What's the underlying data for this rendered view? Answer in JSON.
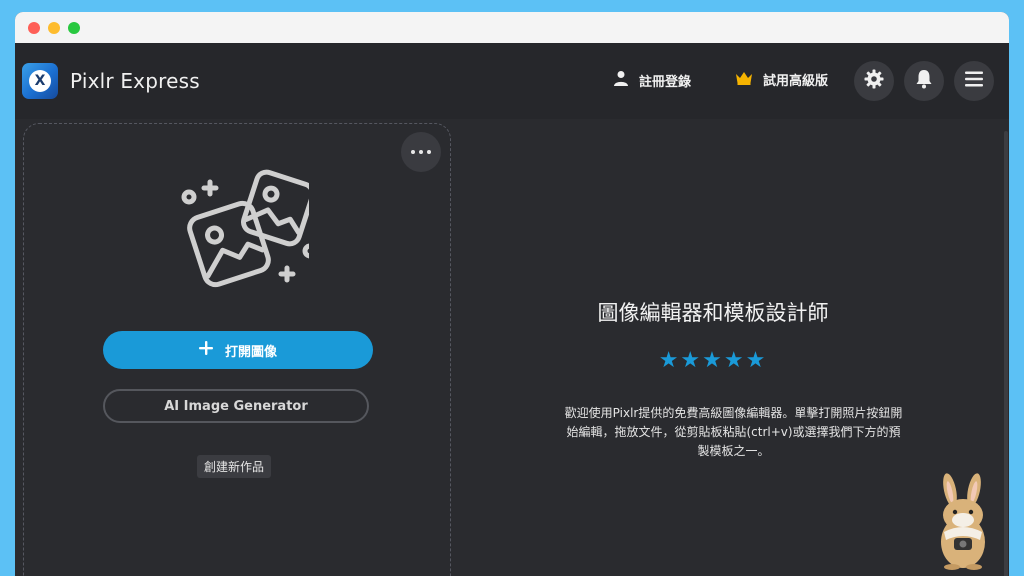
{
  "app": {
    "name": "Pixlr Express",
    "logo_letter": "X"
  },
  "header": {
    "register_label": "註冊登錄",
    "premium_label": "試用高級版",
    "premium_icon_color": "#f5b301"
  },
  "icons": {
    "user": "user-icon",
    "crown": "crown-icon",
    "settings": "gear-icon",
    "bell": "bell-icon",
    "menu": "hamburger-menu-icon",
    "more": "ellipsis-icon",
    "plus": "plus-icon"
  },
  "panel": {
    "open_button_label": "打開圖像",
    "ai_button_label": "AI Image Generator",
    "create_new_label": "創建新作品"
  },
  "hero": {
    "title": "圖像編輯器和模板設計師",
    "rating": 5,
    "stars": "★★★★★",
    "description": "歡迎使用Pixlr提供的免費高級圖像編輯器。單擊打開照片按鈕開始編輯，拖放文件，從剪貼板粘貼(ctrl+v)或選擇我們下方的預製模板之一。"
  },
  "colors": {
    "accent": "#1a9ad8",
    "background": "#2a2b2f",
    "outer": "#5cc1f5"
  }
}
